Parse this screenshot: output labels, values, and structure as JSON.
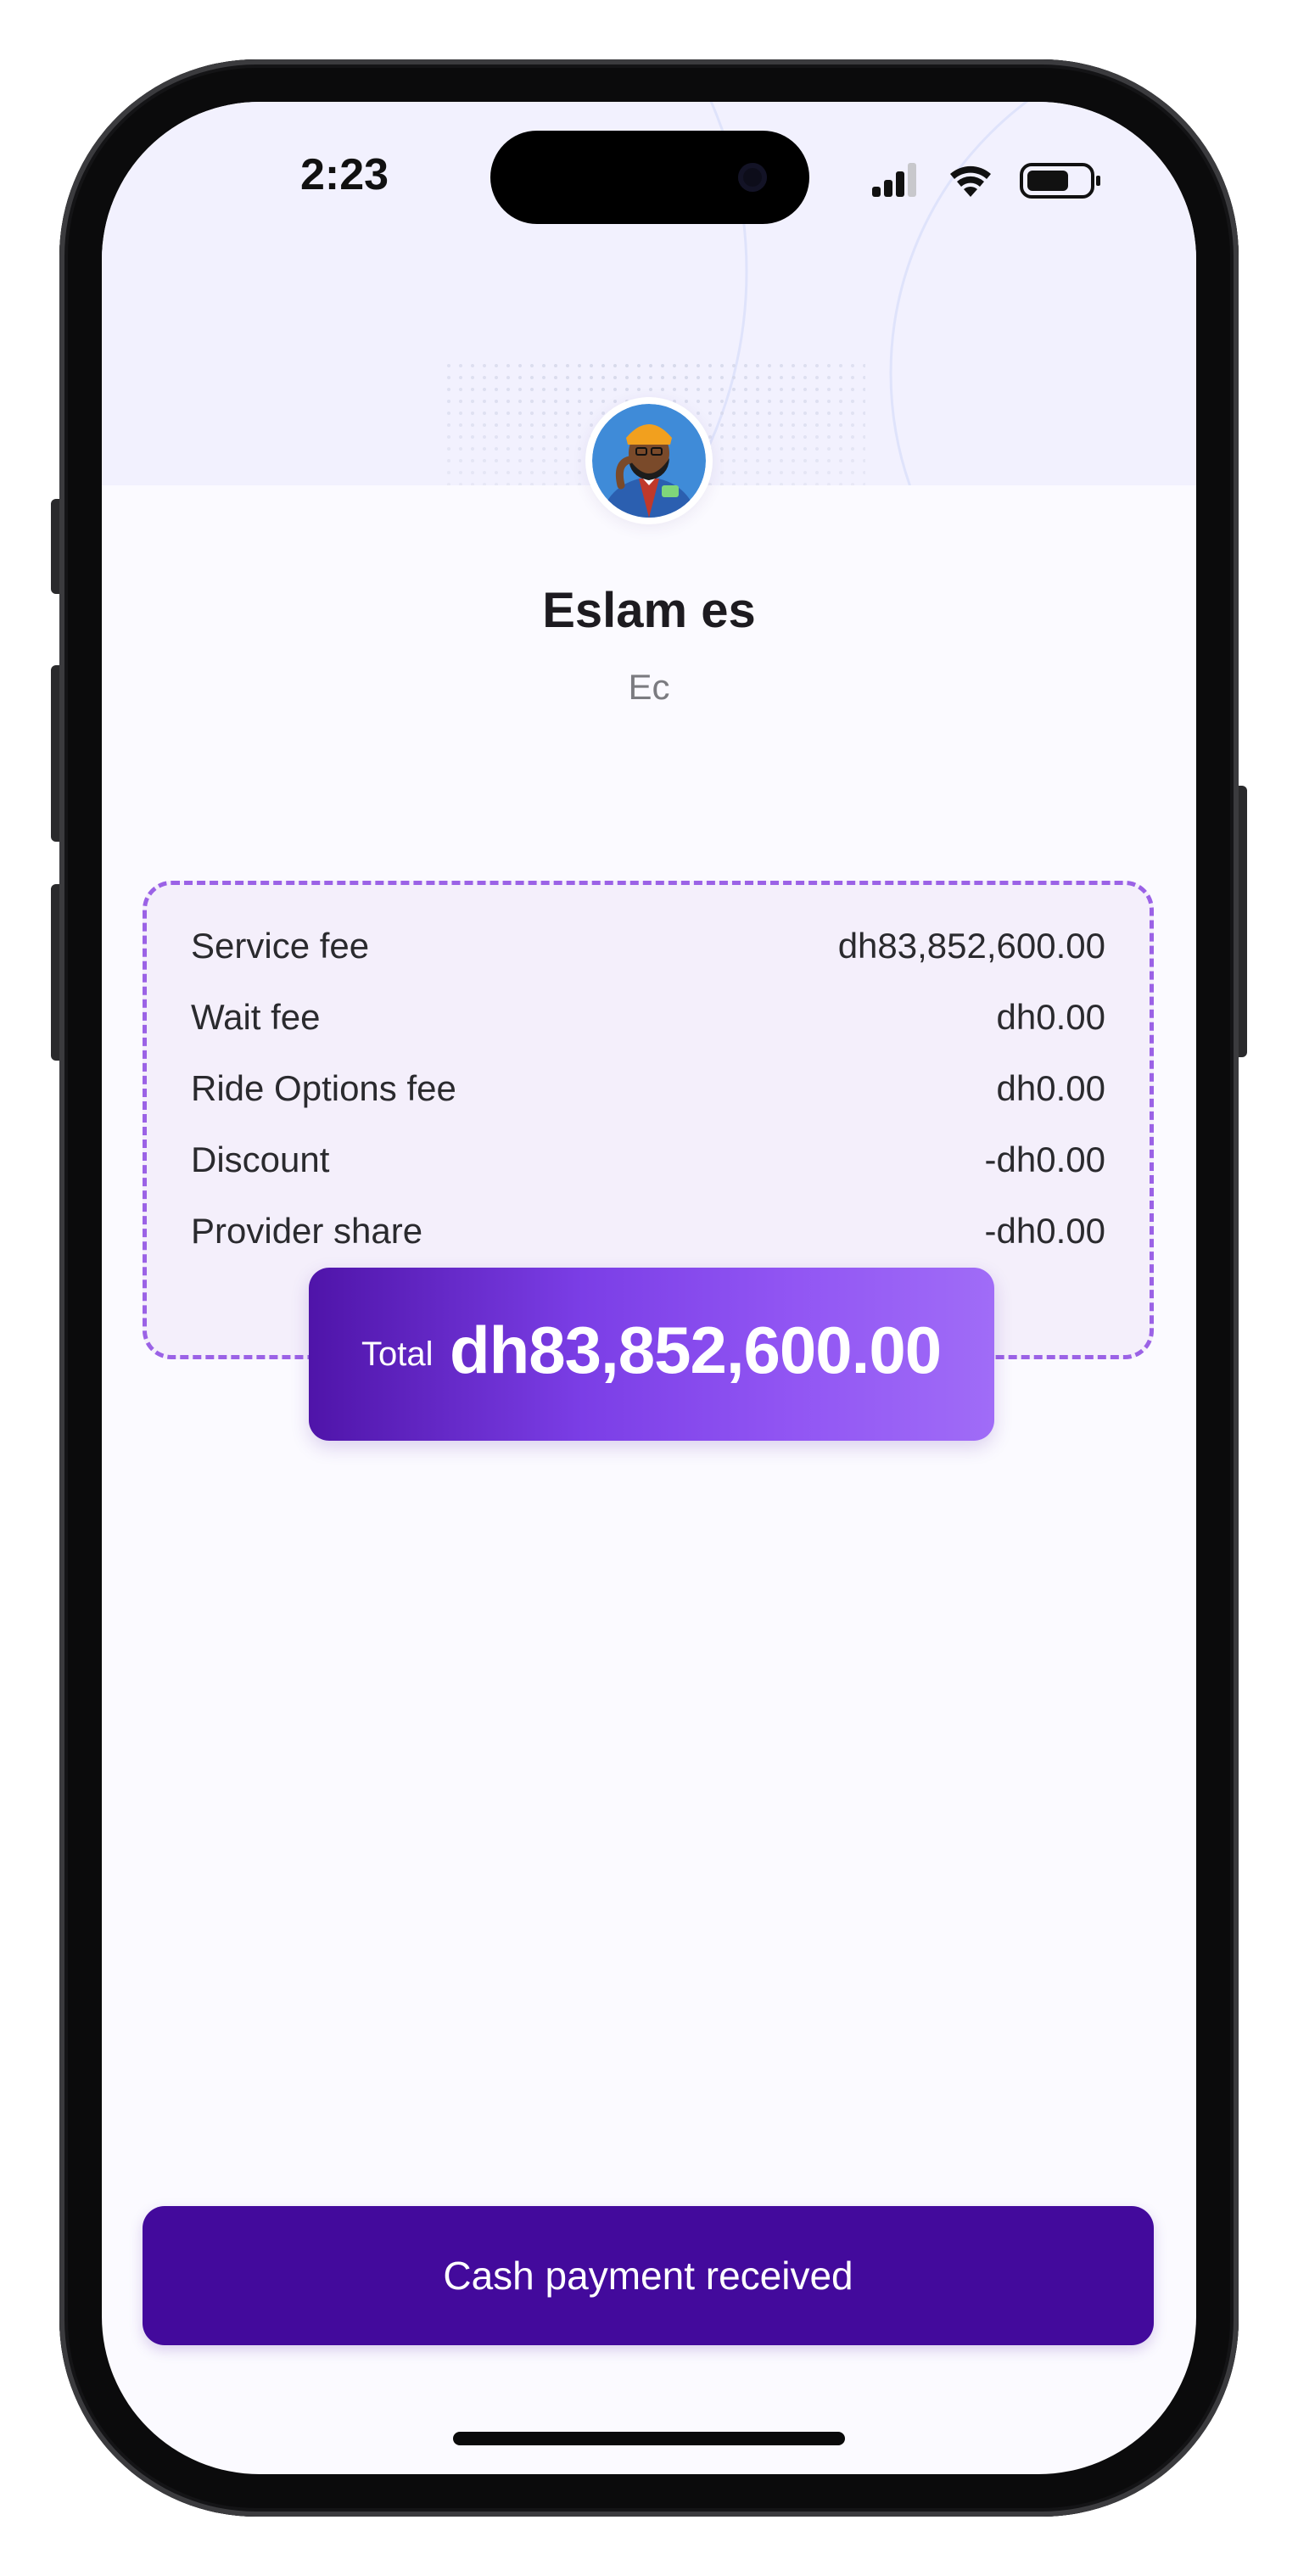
{
  "status_bar": {
    "time": "2:23"
  },
  "profile": {
    "name": "Eslam es",
    "subtitle": "Ec"
  },
  "fees": [
    {
      "label": "Service fee",
      "value": "dh83,852,600.00"
    },
    {
      "label": "Wait fee",
      "value": "dh0.00"
    },
    {
      "label": "Ride Options fee",
      "value": "dh0.00"
    },
    {
      "label": "Discount",
      "value": "-dh0.00"
    },
    {
      "label": "Provider share",
      "value": "-dh0.00"
    }
  ],
  "total": {
    "label": "Total",
    "value": "dh83,852,600.00"
  },
  "actions": {
    "confirm_label": "Cash payment received"
  },
  "icons": {
    "signal": "cellular-signal-icon",
    "wifi": "wifi-icon",
    "battery": "battery-icon"
  },
  "colors": {
    "primary": "#430a9c",
    "accent_dashed": "#9b62e6",
    "card_bg": "#f4effb",
    "header_bg": "#f2f1fe"
  }
}
